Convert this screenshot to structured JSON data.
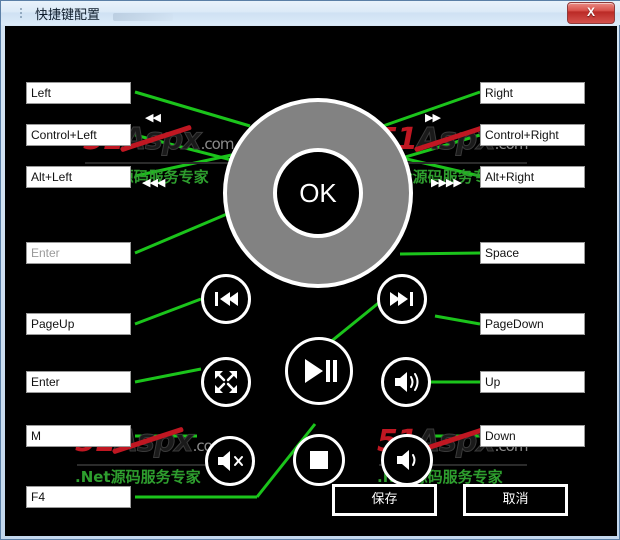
{
  "window": {
    "title": "快捷键配置",
    "close_label": "X",
    "icon": "list-icon"
  },
  "colors": {
    "line_green": "#1bc41b",
    "dial_gray": "#828282",
    "panel_black": "#000000",
    "field_white": "#ffffff",
    "close_red": "#bb2a26",
    "watermark_red": "#c01722",
    "watermark_green": "#2e9e2e"
  },
  "dial": {
    "center_label": "OK",
    "arrow_groups": [
      {
        "name": "rewind-double-left",
        "glyph": "◀◀"
      },
      {
        "name": "forward-double-right",
        "glyph": "▶▶"
      },
      {
        "name": "rewind-triple-left",
        "glyph": "◀◀◀"
      },
      {
        "name": "forward-quad-right",
        "glyph": "▶▶▶▶"
      }
    ]
  },
  "fields": {
    "left": [
      {
        "name": "hotkey-left",
        "value": "Left",
        "placeholder": "",
        "is_placeholder": false
      },
      {
        "name": "hotkey-control-left",
        "value": "Control+Left",
        "placeholder": "",
        "is_placeholder": false
      },
      {
        "name": "hotkey-alt-left",
        "value": "Alt+Left",
        "placeholder": "",
        "is_placeholder": false
      },
      {
        "name": "hotkey-enter-stop",
        "value": "Enter",
        "placeholder": "Enter",
        "is_placeholder": true
      },
      {
        "name": "hotkey-pageup",
        "value": "PageUp",
        "placeholder": "",
        "is_placeholder": false
      },
      {
        "name": "hotkey-enter-fullscreen",
        "value": "Enter",
        "placeholder": "",
        "is_placeholder": false
      },
      {
        "name": "hotkey-mute",
        "value": "M",
        "placeholder": "",
        "is_placeholder": false
      },
      {
        "name": "hotkey-f4",
        "value": "F4",
        "placeholder": "",
        "is_placeholder": false
      }
    ],
    "right": [
      {
        "name": "hotkey-right",
        "value": "Right",
        "placeholder": "",
        "is_placeholder": false
      },
      {
        "name": "hotkey-control-right",
        "value": "Control+Right",
        "placeholder": "",
        "is_placeholder": false
      },
      {
        "name": "hotkey-alt-right",
        "value": "Alt+Right",
        "placeholder": "",
        "is_placeholder": false
      },
      {
        "name": "hotkey-space",
        "value": "Space",
        "placeholder": "",
        "is_placeholder": false
      },
      {
        "name": "hotkey-pagedown",
        "value": "PageDown",
        "placeholder": "",
        "is_placeholder": false
      },
      {
        "name": "hotkey-volume-up",
        "value": "Up",
        "placeholder": "",
        "is_placeholder": false
      },
      {
        "name": "hotkey-volume-down",
        "value": "Down",
        "placeholder": "",
        "is_placeholder": false
      }
    ]
  },
  "media_buttons": [
    {
      "name": "previous-track-button",
      "icon": "previous-track-icon"
    },
    {
      "name": "next-track-button",
      "icon": "next-track-icon"
    },
    {
      "name": "play-pause-button",
      "icon": "play-pause-icon"
    },
    {
      "name": "fullscreen-button",
      "icon": "fullscreen-icon"
    },
    {
      "name": "volume-up-button",
      "icon": "speaker-icon"
    },
    {
      "name": "mute-button",
      "icon": "speaker-mute-icon"
    },
    {
      "name": "stop-button",
      "icon": "stop-icon"
    },
    {
      "name": "volume-down-button",
      "icon": "speaker-low-icon"
    }
  ],
  "actions": {
    "save_label": "保存",
    "cancel_label": "取消"
  },
  "watermark": {
    "brand_51": "51",
    "brand_aspx": "Aspx",
    "brand_com": ".com",
    "tagline": ".Net源码服务专家"
  }
}
